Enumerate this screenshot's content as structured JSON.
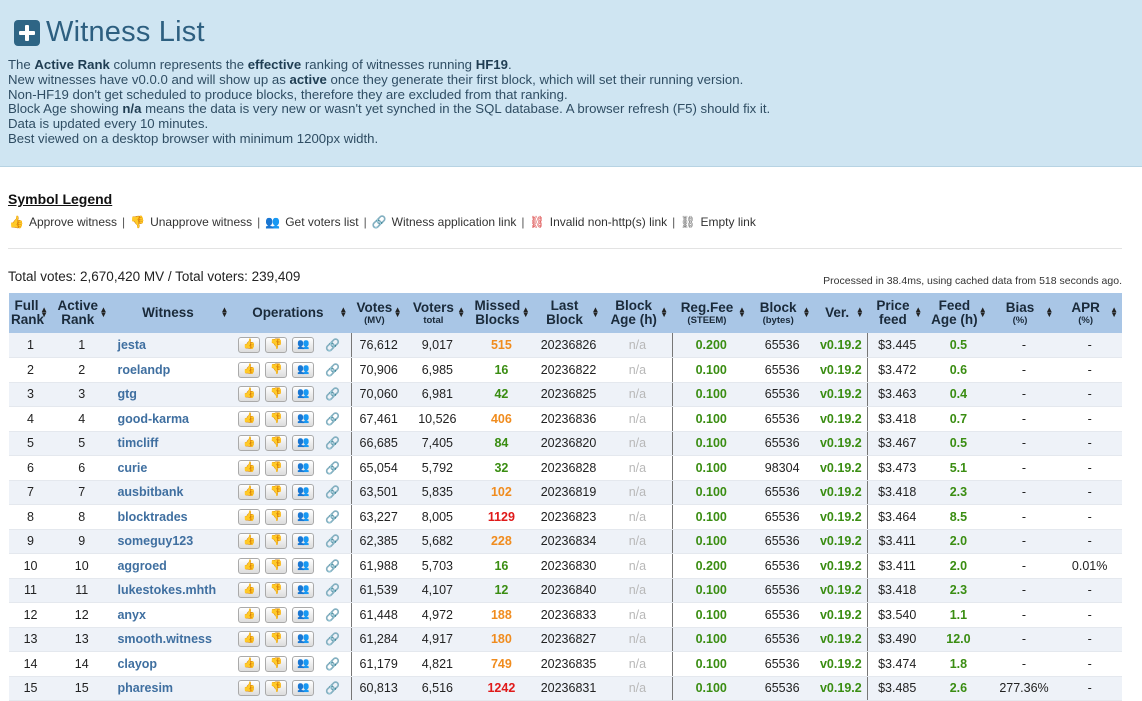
{
  "header": {
    "title": "Witness List",
    "intro": [
      [
        "The ",
        "Active Rank",
        " column represents the ",
        "effective",
        " ranking of witnesses running ",
        "HF19",
        "."
      ],
      [
        "New witnesses have v0.0.0 and will show up as ",
        "active",
        " once they generate their first block, which will set their running version."
      ],
      [
        "Non-HF19 don't get scheduled to produce blocks, therefore they are excluded from that ranking."
      ],
      [
        "Block Age showing ",
        "n/a",
        " means the data is very new or wasn't yet synched in the SQL database. A browser refresh (F5) should fix it."
      ],
      [
        "Data is updated every 10 minutes."
      ],
      [
        "Best viewed on a desktop browser with minimum 1200px width."
      ]
    ]
  },
  "legend": {
    "title": "Symbol Legend",
    "items": [
      {
        "icon": "thumbs-up-icon",
        "glyph": "👍",
        "label": "Approve witness"
      },
      {
        "icon": "thumbs-down-icon",
        "glyph": "👎",
        "label": "Unapprove witness"
      },
      {
        "icon": "user-plus-icon",
        "glyph": "👥",
        "label": "Get voters list"
      },
      {
        "icon": "link-icon",
        "glyph": "🔗",
        "label": "Witness application link"
      },
      {
        "icon": "broken-link-icon",
        "glyph": "⛓",
        "label": "Invalid non-http(s) link"
      },
      {
        "icon": "empty-link-icon",
        "glyph": "⛓",
        "label": "Empty link"
      }
    ]
  },
  "totals": {
    "text": "Total votes: 2,670,420 MV / Total voters: 239,409",
    "processed": "Processed in 38.4ms, using cached data from 518 seconds ago."
  },
  "table": {
    "columns": [
      {
        "label": "Full Rank",
        "sub": ""
      },
      {
        "label": "Active Rank",
        "sub": ""
      },
      {
        "label": "Witness",
        "sub": ""
      },
      {
        "label": "Operations",
        "sub": ""
      },
      {
        "label": "Votes",
        "sub": "(MV)"
      },
      {
        "label": "Voters",
        "sub": "total"
      },
      {
        "label": "Missed Blocks",
        "sub": ""
      },
      {
        "label": "Last Block",
        "sub": ""
      },
      {
        "label": "Block Age (h)",
        "sub": ""
      },
      {
        "label": "Reg.Fee",
        "sub": "(STEEM)"
      },
      {
        "label": "Block",
        "sub": "(bytes)"
      },
      {
        "label": "Ver.",
        "sub": ""
      },
      {
        "label": "Price feed",
        "sub": ""
      },
      {
        "label": "Feed Age (h)",
        "sub": ""
      },
      {
        "label": "Bias",
        "sub": "(%)"
      },
      {
        "label": "APR",
        "sub": "(%)"
      }
    ],
    "rows": [
      {
        "full": "1",
        "active": "1",
        "name": "jesta",
        "votes": "76,612",
        "voters": "9,017",
        "missed": "515",
        "missed_level": "orange",
        "last": "20236826",
        "age": "n/a",
        "fee": "0.200",
        "block": "65536",
        "ver": "v0.19.2",
        "price": "$3.445",
        "feed_age": "0.5",
        "bias": "-",
        "apr": "-"
      },
      {
        "full": "2",
        "active": "2",
        "name": "roelandp",
        "votes": "70,906",
        "voters": "6,985",
        "missed": "16",
        "missed_level": "green",
        "last": "20236822",
        "age": "n/a",
        "fee": "0.100",
        "block": "65536",
        "ver": "v0.19.2",
        "price": "$3.472",
        "feed_age": "0.6",
        "bias": "-",
        "apr": "-"
      },
      {
        "full": "3",
        "active": "3",
        "name": "gtg",
        "votes": "70,060",
        "voters": "6,981",
        "missed": "42",
        "missed_level": "green",
        "last": "20236825",
        "age": "n/a",
        "fee": "0.100",
        "block": "65536",
        "ver": "v0.19.2",
        "price": "$3.463",
        "feed_age": "0.4",
        "bias": "-",
        "apr": "-"
      },
      {
        "full": "4",
        "active": "4",
        "name": "good-karma",
        "votes": "67,461",
        "voters": "10,526",
        "missed": "406",
        "missed_level": "orange",
        "last": "20236836",
        "age": "n/a",
        "fee": "0.100",
        "block": "65536",
        "ver": "v0.19.2",
        "price": "$3.418",
        "feed_age": "0.7",
        "bias": "-",
        "apr": "-"
      },
      {
        "full": "5",
        "active": "5",
        "name": "timcliff",
        "votes": "66,685",
        "voters": "7,405",
        "missed": "84",
        "missed_level": "green",
        "last": "20236820",
        "age": "n/a",
        "fee": "0.100",
        "block": "65536",
        "ver": "v0.19.2",
        "price": "$3.467",
        "feed_age": "0.5",
        "bias": "-",
        "apr": "-"
      },
      {
        "full": "6",
        "active": "6",
        "name": "curie",
        "votes": "65,054",
        "voters": "5,792",
        "missed": "32",
        "missed_level": "green",
        "last": "20236828",
        "age": "n/a",
        "fee": "0.100",
        "block": "98304",
        "ver": "v0.19.2",
        "price": "$3.473",
        "feed_age": "5.1",
        "bias": "-",
        "apr": "-"
      },
      {
        "full": "7",
        "active": "7",
        "name": "ausbitbank",
        "votes": "63,501",
        "voters": "5,835",
        "missed": "102",
        "missed_level": "orange",
        "last": "20236819",
        "age": "n/a",
        "fee": "0.100",
        "block": "65536",
        "ver": "v0.19.2",
        "price": "$3.418",
        "feed_age": "2.3",
        "bias": "-",
        "apr": "-"
      },
      {
        "full": "8",
        "active": "8",
        "name": "blocktrades",
        "votes": "63,227",
        "voters": "8,005",
        "missed": "1129",
        "missed_level": "red",
        "last": "20236823",
        "age": "n/a",
        "fee": "0.100",
        "block": "65536",
        "ver": "v0.19.2",
        "price": "$3.464",
        "feed_age": "8.5",
        "bias": "-",
        "apr": "-"
      },
      {
        "full": "9",
        "active": "9",
        "name": "someguy123",
        "votes": "62,385",
        "voters": "5,682",
        "missed": "228",
        "missed_level": "orange",
        "last": "20236834",
        "age": "n/a",
        "fee": "0.100",
        "block": "65536",
        "ver": "v0.19.2",
        "price": "$3.411",
        "feed_age": "2.0",
        "bias": "-",
        "apr": "-"
      },
      {
        "full": "10",
        "active": "10",
        "name": "aggroed",
        "votes": "61,988",
        "voters": "5,703",
        "missed": "16",
        "missed_level": "green",
        "last": "20236830",
        "age": "n/a",
        "fee": "0.200",
        "block": "65536",
        "ver": "v0.19.2",
        "price": "$3.411",
        "feed_age": "2.0",
        "bias": "-",
        "apr": "0.01%"
      },
      {
        "full": "11",
        "active": "11",
        "name": "lukestokes.mhth",
        "votes": "61,539",
        "voters": "4,107",
        "missed": "12",
        "missed_level": "green",
        "last": "20236840",
        "age": "n/a",
        "fee": "0.100",
        "block": "65536",
        "ver": "v0.19.2",
        "price": "$3.418",
        "feed_age": "2.3",
        "bias": "-",
        "apr": "-"
      },
      {
        "full": "12",
        "active": "12",
        "name": "anyx",
        "votes": "61,448",
        "voters": "4,972",
        "missed": "188",
        "missed_level": "orange",
        "last": "20236833",
        "age": "n/a",
        "fee": "0.100",
        "block": "65536",
        "ver": "v0.19.2",
        "price": "$3.540",
        "feed_age": "1.1",
        "bias": "-",
        "apr": "-"
      },
      {
        "full": "13",
        "active": "13",
        "name": "smooth.witness",
        "votes": "61,284",
        "voters": "4,917",
        "missed": "180",
        "missed_level": "orange",
        "last": "20236827",
        "age": "n/a",
        "fee": "0.100",
        "block": "65536",
        "ver": "v0.19.2",
        "price": "$3.490",
        "feed_age": "12.0",
        "bias": "-",
        "apr": "-"
      },
      {
        "full": "14",
        "active": "14",
        "name": "clayop",
        "votes": "61,179",
        "voters": "4,821",
        "missed": "749",
        "missed_level": "orange",
        "last": "20236835",
        "age": "n/a",
        "fee": "0.100",
        "block": "65536",
        "ver": "v0.19.2",
        "price": "$3.474",
        "feed_age": "1.8",
        "bias": "-",
        "apr": "-"
      },
      {
        "full": "15",
        "active": "15",
        "name": "pharesim",
        "votes": "60,813",
        "voters": "6,516",
        "missed": "1242",
        "missed_level": "red",
        "last": "20236831",
        "age": "n/a",
        "fee": "0.100",
        "block": "65536",
        "ver": "v0.19.2",
        "price": "$3.485",
        "feed_age": "2.6",
        "bias": "277.36%",
        "apr": "-"
      }
    ]
  }
}
